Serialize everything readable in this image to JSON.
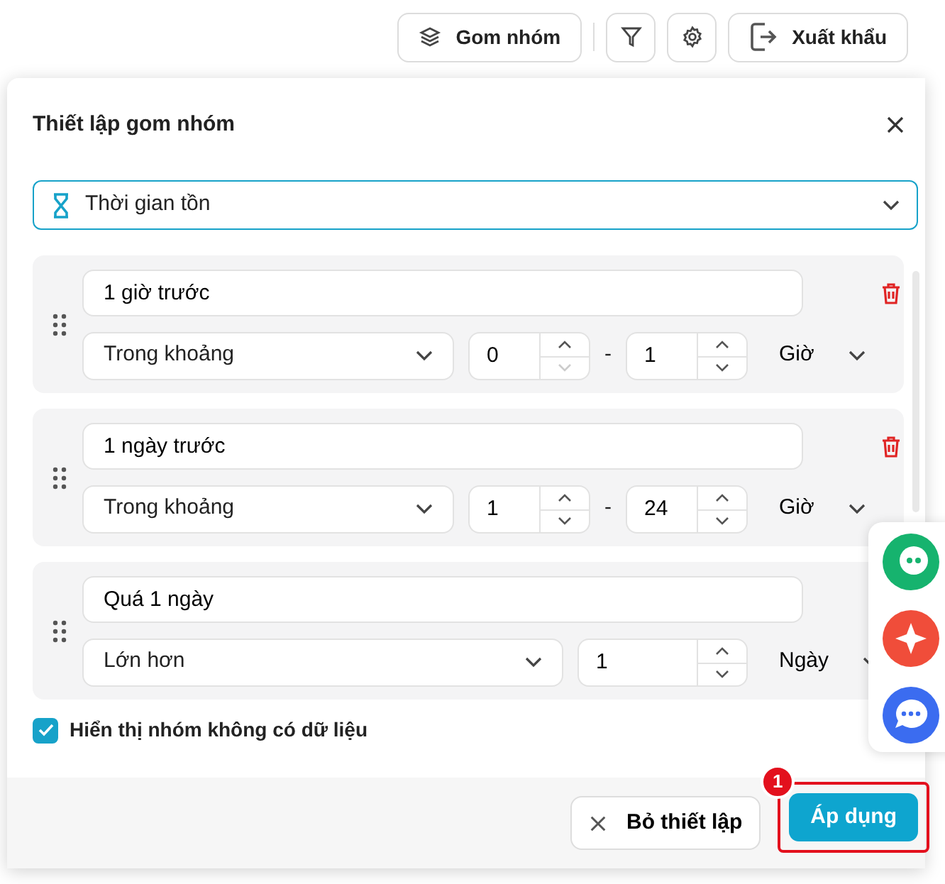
{
  "toolbar": {
    "group_button": "Gom nhóm",
    "export_button": "Xuất khẩu"
  },
  "dialog": {
    "title": "Thiết lập gom nhóm",
    "field_select": "Thời gian tồn",
    "groups": [
      {
        "kind": "range",
        "name": "1 giờ trước",
        "condition": "Trong khoảng",
        "from": {
          "value": "0",
          "decrement_disabled": true
        },
        "separator": "-",
        "to": {
          "value": "1",
          "decrement_disabled": false
        },
        "unit": "Giờ"
      },
      {
        "kind": "range",
        "name": "1 ngày trước",
        "condition": "Trong khoảng",
        "from": {
          "value": "1",
          "decrement_disabled": false
        },
        "separator": "-",
        "to": {
          "value": "24",
          "decrement_disabled": false
        },
        "unit": "Giờ"
      },
      {
        "kind": "greater",
        "name": "Quá 1 ngày",
        "condition": "Lớn hơn",
        "from": {
          "value": "1",
          "decrement_disabled": false
        },
        "unit": "Ngày"
      }
    ],
    "show_empty": {
      "label": "Hiển thị nhóm không có dữ liệu",
      "checked": true
    },
    "reset_button": "Bỏ thiết lập",
    "apply_button": "Áp dụng"
  },
  "annotation": {
    "label": "1"
  }
}
